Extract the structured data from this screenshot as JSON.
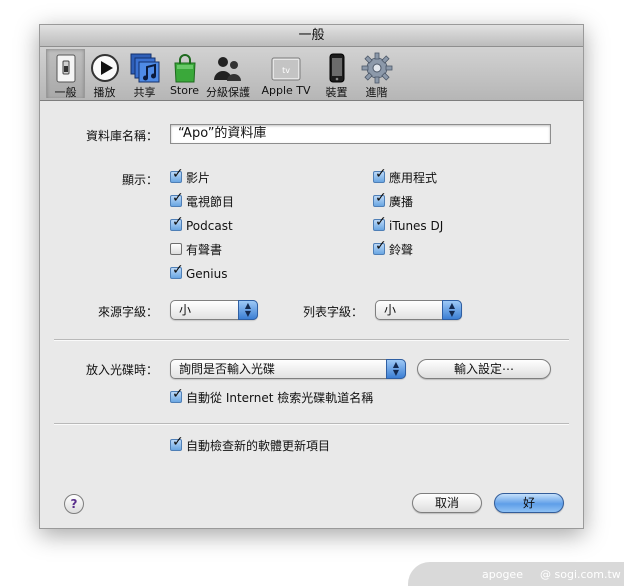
{
  "window": {
    "title": "一般"
  },
  "toolbar": {
    "items": [
      {
        "label": "一般"
      },
      {
        "label": "播放"
      },
      {
        "label": "共享"
      },
      {
        "label": "Store"
      },
      {
        "label": "分級保護"
      },
      {
        "label": "Apple TV"
      },
      {
        "label": "裝置"
      },
      {
        "label": "進階"
      }
    ],
    "appletv_badge": "tv"
  },
  "library": {
    "label": "資料庫名稱：",
    "value": "“Apo”的資料庫"
  },
  "show": {
    "label": "顯示：",
    "items": [
      {
        "label": "影片",
        "checked": true
      },
      {
        "label": "電視節目",
        "checked": true
      },
      {
        "label": "Podcast",
        "checked": true
      },
      {
        "label": "有聲書",
        "checked": false
      },
      {
        "label": "Genius",
        "checked": true
      },
      {
        "label": "應用程式",
        "checked": true
      },
      {
        "label": "廣播",
        "checked": true
      },
      {
        "label": "iTunes DJ",
        "checked": true
      },
      {
        "label": "鈴聲",
        "checked": true
      }
    ]
  },
  "source_text": {
    "label": "來源字級：",
    "value": "小"
  },
  "list_text": {
    "label": "列表字級：",
    "value": "小"
  },
  "cd_insert": {
    "label": "放入光碟時：",
    "value": "詢問是否輸入光碟",
    "import_settings_label": "輸入設定⋯"
  },
  "auto_lookup": {
    "label": "自動從 Internet 檢索光碟軌道名稱",
    "checked": true
  },
  "auto_update": {
    "label": "自動檢查新的軟體更新項目",
    "checked": true
  },
  "buttons": {
    "help": "?",
    "cancel": "取消",
    "ok": "好"
  },
  "footer": {
    "left": "apogee",
    "right": "@ sogi.com.tw"
  }
}
